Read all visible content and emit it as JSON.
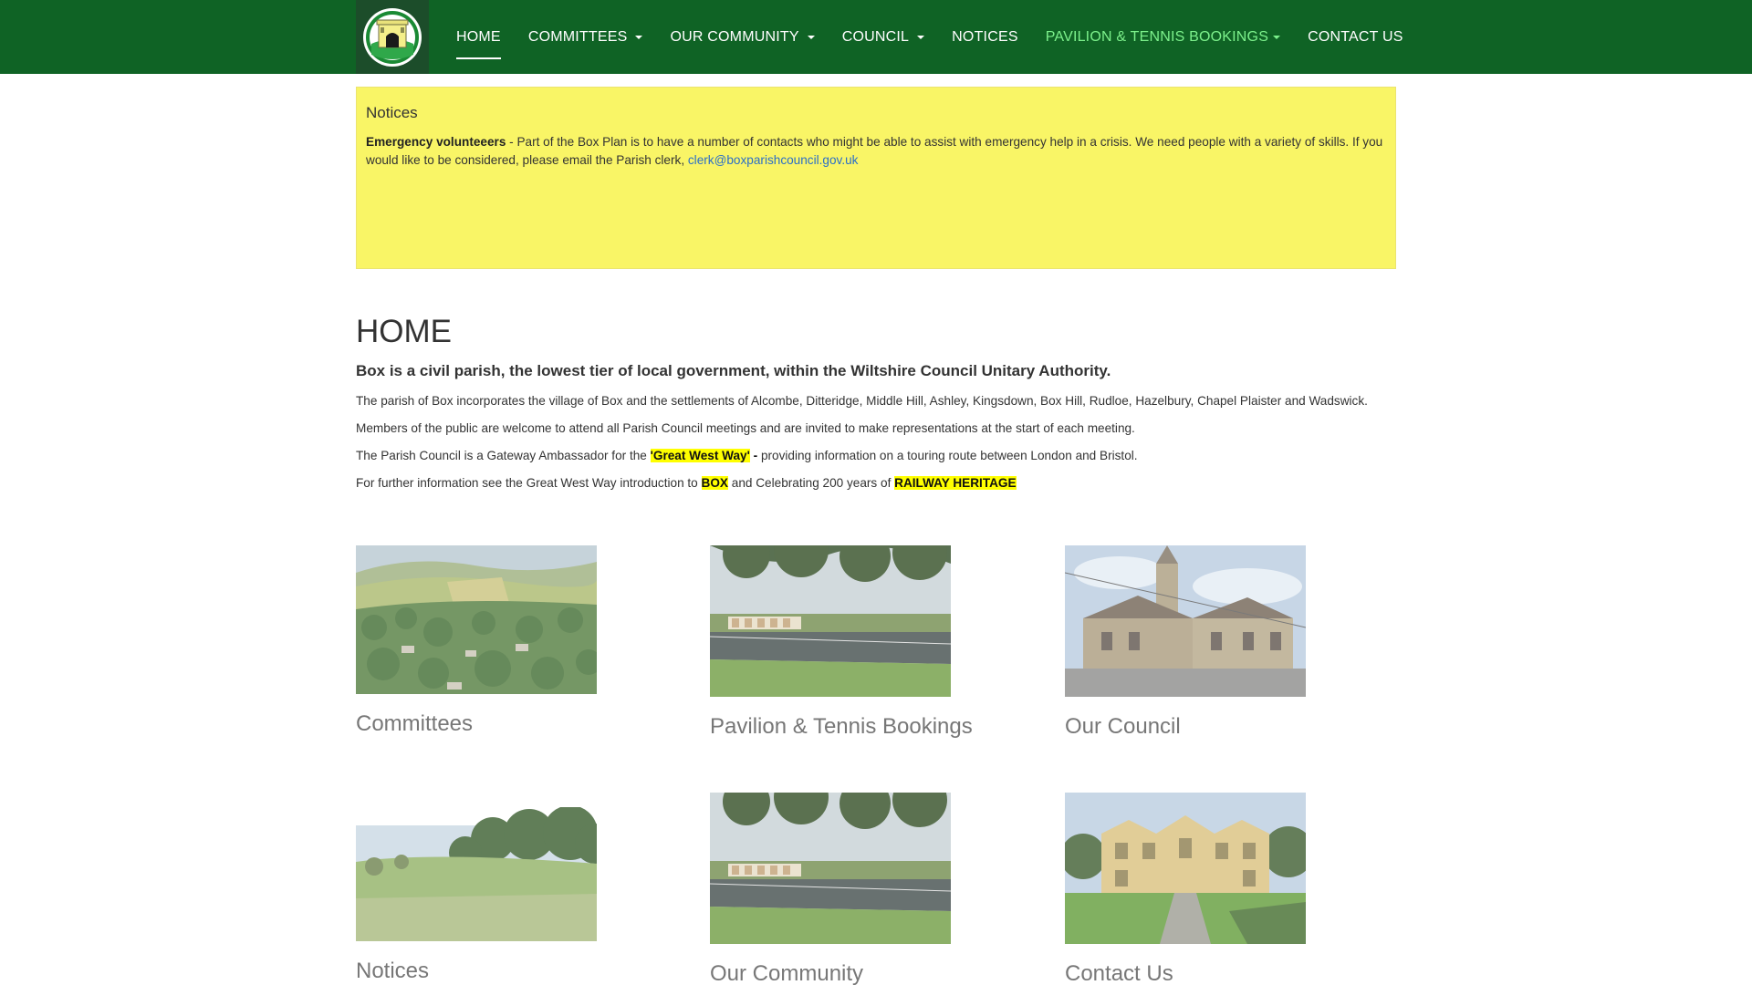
{
  "nav": {
    "items": [
      {
        "label": "HOME",
        "active": true,
        "dropdown": false
      },
      {
        "label": "COMMITTEES",
        "dropdown": true
      },
      {
        "label": "OUR COMMUNITY",
        "dropdown": true
      },
      {
        "label": "COUNCIL",
        "dropdown": true
      },
      {
        "label": "NOTICES",
        "dropdown": false
      },
      {
        "label": "PAVILION & TENNIS BOOKINGS",
        "dropdown": true,
        "highlight": true
      },
      {
        "label": "CONTACT US",
        "dropdown": false
      }
    ],
    "colors": {
      "background": "#0f6325",
      "highlight": "#7cf08b"
    }
  },
  "notice": {
    "title": "Notices",
    "bold_lead": "Emergency volunteeers",
    "text": " - Part of the Box Plan is to have a number of contacts who might be able to assist with emergency help in a crisis.  We need people with a variety of skills. If you would like to be considered, please email the Parish clerk, ",
    "email": "clerk@boxparishcouncil.gov.uk",
    "background": "#f9f566"
  },
  "main": {
    "title": "HOME",
    "lead": "Box is a civil parish, the lowest tier of local government, within the Wiltshire Council Unitary Authority.",
    "p1": "The parish of Box incorporates the village of Box and the settlements of Alcombe, Ditteridge, Middle Hill, Ashley, Kingsdown, Box Hill, Rudloe, Hazelbury, Chapel Plaister and Wadswick.",
    "p2": "Members of the public are welcome to attend all Parish Council meetings and are invited to make representations at the start of each meeting.",
    "p3_before": "The Parish Council is a Gateway Ambassador for the ",
    "p3_highlight": "'Great West Way'",
    "p3_dash": " - ",
    "p3_after": "providing information on a touring route between London and Bristol.",
    "p4_before": "For further information see the Great West Way introduction to ",
    "p4_box": "BOX",
    "p4_mid": " and Celebrating 200 years of ",
    "p4_rail": "RAILWAY HERITAGE"
  },
  "tiles": [
    {
      "caption": "Committees"
    },
    {
      "caption": "Pavilion & Tennis Bookings"
    },
    {
      "caption": "Our Council"
    },
    {
      "caption": "Notices"
    },
    {
      "caption": "Our Community"
    },
    {
      "caption": "Contact Us"
    }
  ]
}
